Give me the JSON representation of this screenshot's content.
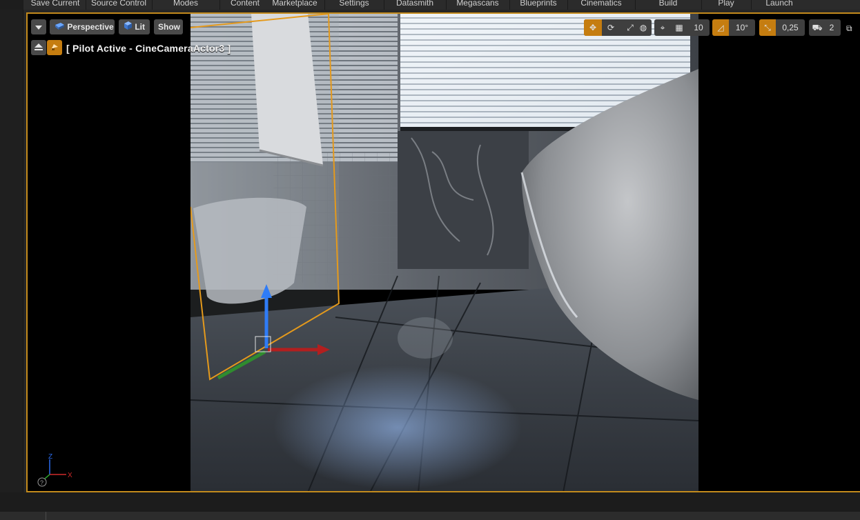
{
  "toolbar": {
    "items": [
      {
        "label": "Save Current"
      },
      {
        "label": "Source Control"
      },
      {
        "label": "Modes"
      },
      {
        "label": "Content"
      },
      {
        "label": "Marketplace"
      },
      {
        "label": "Settings"
      },
      {
        "label": "Datasmith"
      },
      {
        "label": "Megascans"
      },
      {
        "label": "Blueprints"
      },
      {
        "label": "Cinematics"
      },
      {
        "label": "Build"
      },
      {
        "label": "Play"
      },
      {
        "label": "Launch"
      }
    ]
  },
  "viewport": {
    "view_mode": "Perspective",
    "lighting_mode": "Lit",
    "show_label": "Show",
    "pilot_text": "[ Pilot Active - CineCameraActor3 ]",
    "grid_snap": "10",
    "rotation_snap": "10°",
    "scale_snap": "0,25",
    "camera_speed": "2",
    "accent_color": "#c57d10",
    "border_color": "#c48b1c",
    "axis": {
      "x": "X",
      "z": "Z"
    }
  },
  "icons": {
    "dropdown": "chevron-down-icon",
    "perspective": "perspective-cube-icon",
    "lit": "lit-sphere-icon",
    "eject": "eject-icon",
    "pilot": "pilot-camera-icon",
    "translate": "translate-icon",
    "rotate": "rotate-icon",
    "scale": "scale-icon",
    "world": "world-local-icon",
    "surface_snap": "surface-snap-icon",
    "grid": "grid-icon",
    "angle": "angle-snap-icon",
    "scale_snap": "scale-snap-icon",
    "camera_speed": "camera-speed-icon",
    "maximize": "maximize-icon",
    "help": "help-icon"
  }
}
